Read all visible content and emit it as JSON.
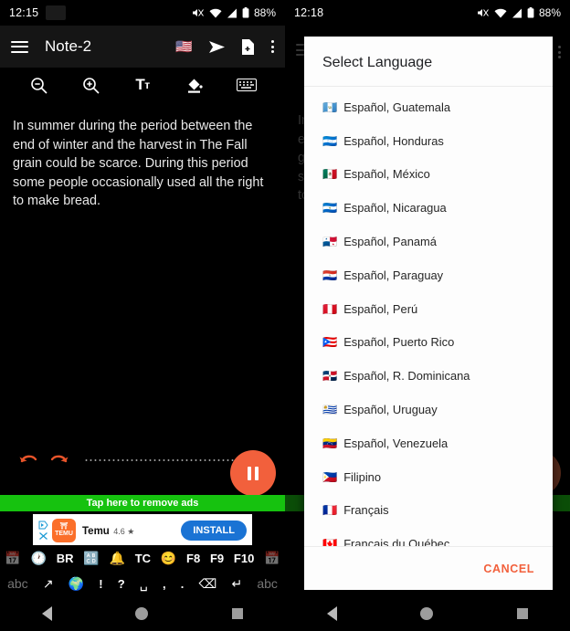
{
  "left": {
    "status": {
      "time": "12:15",
      "battery": "88%"
    },
    "appbar": {
      "title": "Note-2",
      "flag": "🇺🇸"
    },
    "toolbar": [
      {
        "name": "zoom-out-icon",
        "label": "zoom out"
      },
      {
        "name": "zoom-in-icon",
        "label": "zoom in"
      },
      {
        "name": "text-size-icon",
        "label": "Tт"
      },
      {
        "name": "fill-color-icon",
        "label": "fill color"
      },
      {
        "name": "keyboard-icon",
        "label": "keyboard"
      }
    ],
    "note": "In summer during the period between the end of winter and the harvest in The Fall grain could be scarce. During this period some people occasionally used all the right to make bread.",
    "ads": {
      "banner": "Tap here to remove ads",
      "app_name": "Temu",
      "rating": "4.6 ★",
      "icon_text": "TEMU",
      "install": "INSTALL"
    },
    "keyboard": {
      "row1": [
        "📅",
        "🕐",
        "BR",
        "🔠",
        "🔔",
        "TC",
        "😊",
        "F8",
        "F9",
        "F10",
        "📅"
      ],
      "row2": [
        "abc",
        "↗",
        "🌍",
        "!",
        "?",
        "␣",
        ",",
        ".",
        "⌫",
        "↵",
        "abc"
      ]
    }
  },
  "right": {
    "status": {
      "time": "12:18",
      "battery": "88%"
    },
    "dialog": {
      "title": "Select Language",
      "cancel": "CANCEL",
      "items": [
        {
          "flag": "🇬🇹",
          "label": "Español, Guatemala"
        },
        {
          "flag": "🇭🇳",
          "label": "Español, Honduras"
        },
        {
          "flag": "🇲🇽",
          "label": "Español, México"
        },
        {
          "flag": "🇳🇮",
          "label": "Español, Nicaragua"
        },
        {
          "flag": "🇵🇦",
          "label": "Español, Panamá"
        },
        {
          "flag": "🇵🇾",
          "label": "Español, Paraguay"
        },
        {
          "flag": "🇵🇪",
          "label": "Español, Perú"
        },
        {
          "flag": "🇵🇷",
          "label": "Español, Puerto Rico"
        },
        {
          "flag": "🇩🇴",
          "label": "Español, R. Dominicana"
        },
        {
          "flag": "🇺🇾",
          "label": "Español, Uruguay"
        },
        {
          "flag": "🇻🇪",
          "label": "Español, Venezuela"
        },
        {
          "flag": "🇵🇭",
          "label": "Filipino"
        },
        {
          "flag": "🇫🇷",
          "label": "Français"
        },
        {
          "flag": "🇨🇦",
          "label": "Français du Québec"
        }
      ]
    },
    "background_note": "In summer during the period between the end of winter and the harvest in The Fall grain could be scarce. During this period some people occasionally used all the right to make bread."
  },
  "colors": {
    "accent": "#f2603c",
    "ad_green": "#16c20f",
    "install_blue": "#1a73d4"
  }
}
